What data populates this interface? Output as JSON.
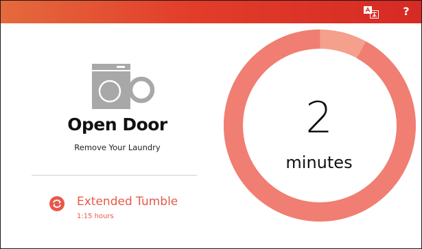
{
  "colors": {
    "accent": "#e8584a",
    "header_start": "#e56a3d",
    "header_end": "#d62a24",
    "ring": "#f07e72",
    "ring_remaining": "#f5a08c",
    "icon_gray": "#a8a8a8"
  },
  "header": {
    "language_icon": "translate-icon",
    "help_label": "?"
  },
  "status": {
    "icon": "washer-door-open-icon",
    "title": "Open Door",
    "subtitle": "Remove Your Laundry"
  },
  "option": {
    "icon": "cycle-refresh-icon",
    "label": "Extended Tumble",
    "duration": "1:15 hours"
  },
  "timer": {
    "value": "2",
    "unit": "minutes",
    "progress": 0.92
  }
}
